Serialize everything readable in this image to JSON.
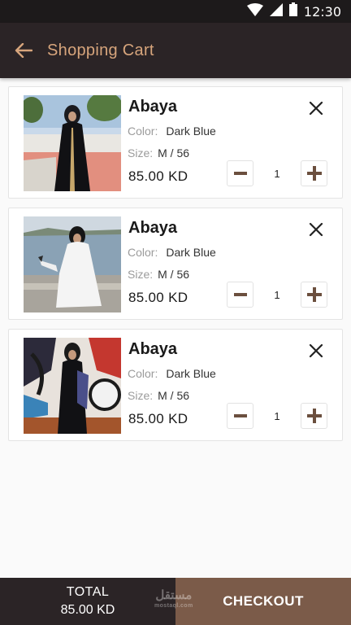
{
  "status_bar": {
    "time": "12:30"
  },
  "app_bar": {
    "title": "Shopping Cart"
  },
  "labels": {
    "color": "Color:",
    "size": "Size:"
  },
  "cart": {
    "items": [
      {
        "name": "Abaya",
        "color": "Dark Blue",
        "size": "M / 56",
        "price": "85.00 KD",
        "quantity": "1"
      },
      {
        "name": "Abaya",
        "color": "Dark Blue",
        "size": "M / 56",
        "price": "85.00 KD",
        "quantity": "1"
      },
      {
        "name": "Abaya",
        "color": "Dark Blue",
        "size": "M / 56",
        "price": "85.00 KD",
        "quantity": "1"
      }
    ]
  },
  "footer": {
    "total_label": "TOTAL",
    "total_value": "85.00 KD",
    "checkout_label": "CHECKOUT",
    "watermark": "مستقل",
    "watermark_sub": "mostaql.com"
  },
  "colors": {
    "header_bg": "#2b2426",
    "accent": "#d7a57c",
    "checkout_bg": "#7b5b49",
    "qty_icon": "#6b4f3e"
  },
  "icons": [
    "wifi-icon",
    "signal-icon",
    "battery-icon",
    "back-arrow-icon",
    "close-icon",
    "minus-icon",
    "plus-icon"
  ]
}
